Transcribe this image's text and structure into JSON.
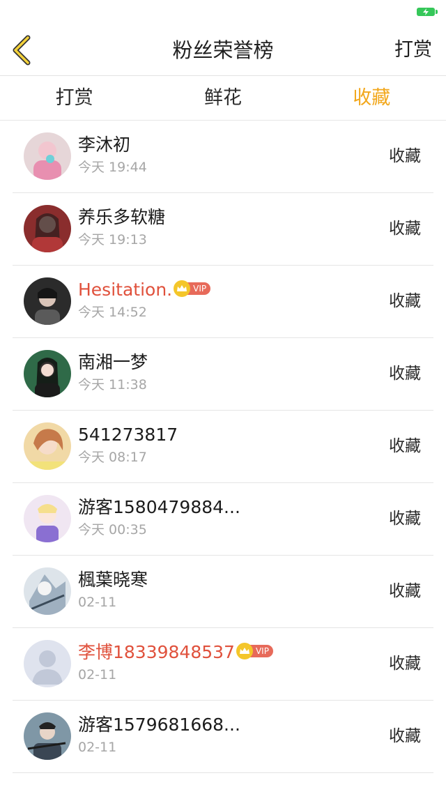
{
  "header": {
    "title": "粉丝荣誉榜",
    "right_action": "打赏"
  },
  "tabs": [
    {
      "label": "打赏",
      "active": false
    },
    {
      "label": "鲜花",
      "active": false
    },
    {
      "label": "收藏",
      "active": true
    }
  ],
  "colors": {
    "accent": "#f2a71b",
    "vip_name": "#e0513c",
    "battery": "#35c759"
  },
  "vip_label": "VIP",
  "fans": [
    {
      "name": "李沐初",
      "time": "今天 19:44",
      "action": "收藏",
      "vip": false
    },
    {
      "name": "养乐多软糖",
      "time": "今天 19:13",
      "action": "收藏",
      "vip": false
    },
    {
      "name": "Hesitation.",
      "time": "今天 14:52",
      "action": "收藏",
      "vip": true
    },
    {
      "name": "南湘一梦",
      "time": "今天 11:38",
      "action": "收藏",
      "vip": false
    },
    {
      "name": "541273817",
      "time": "今天 08:17",
      "action": "收藏",
      "vip": false
    },
    {
      "name": "游客1580479884...",
      "time": "今天 00:35",
      "action": "收藏",
      "vip": false
    },
    {
      "name": "楓葉晓寒",
      "time": "02-11",
      "action": "收藏",
      "vip": false
    },
    {
      "name": "李博18339848537",
      "time": "02-11",
      "action": "收藏",
      "vip": true
    },
    {
      "name": "游客1579681668...",
      "time": "02-11",
      "action": "收藏",
      "vip": false
    }
  ]
}
